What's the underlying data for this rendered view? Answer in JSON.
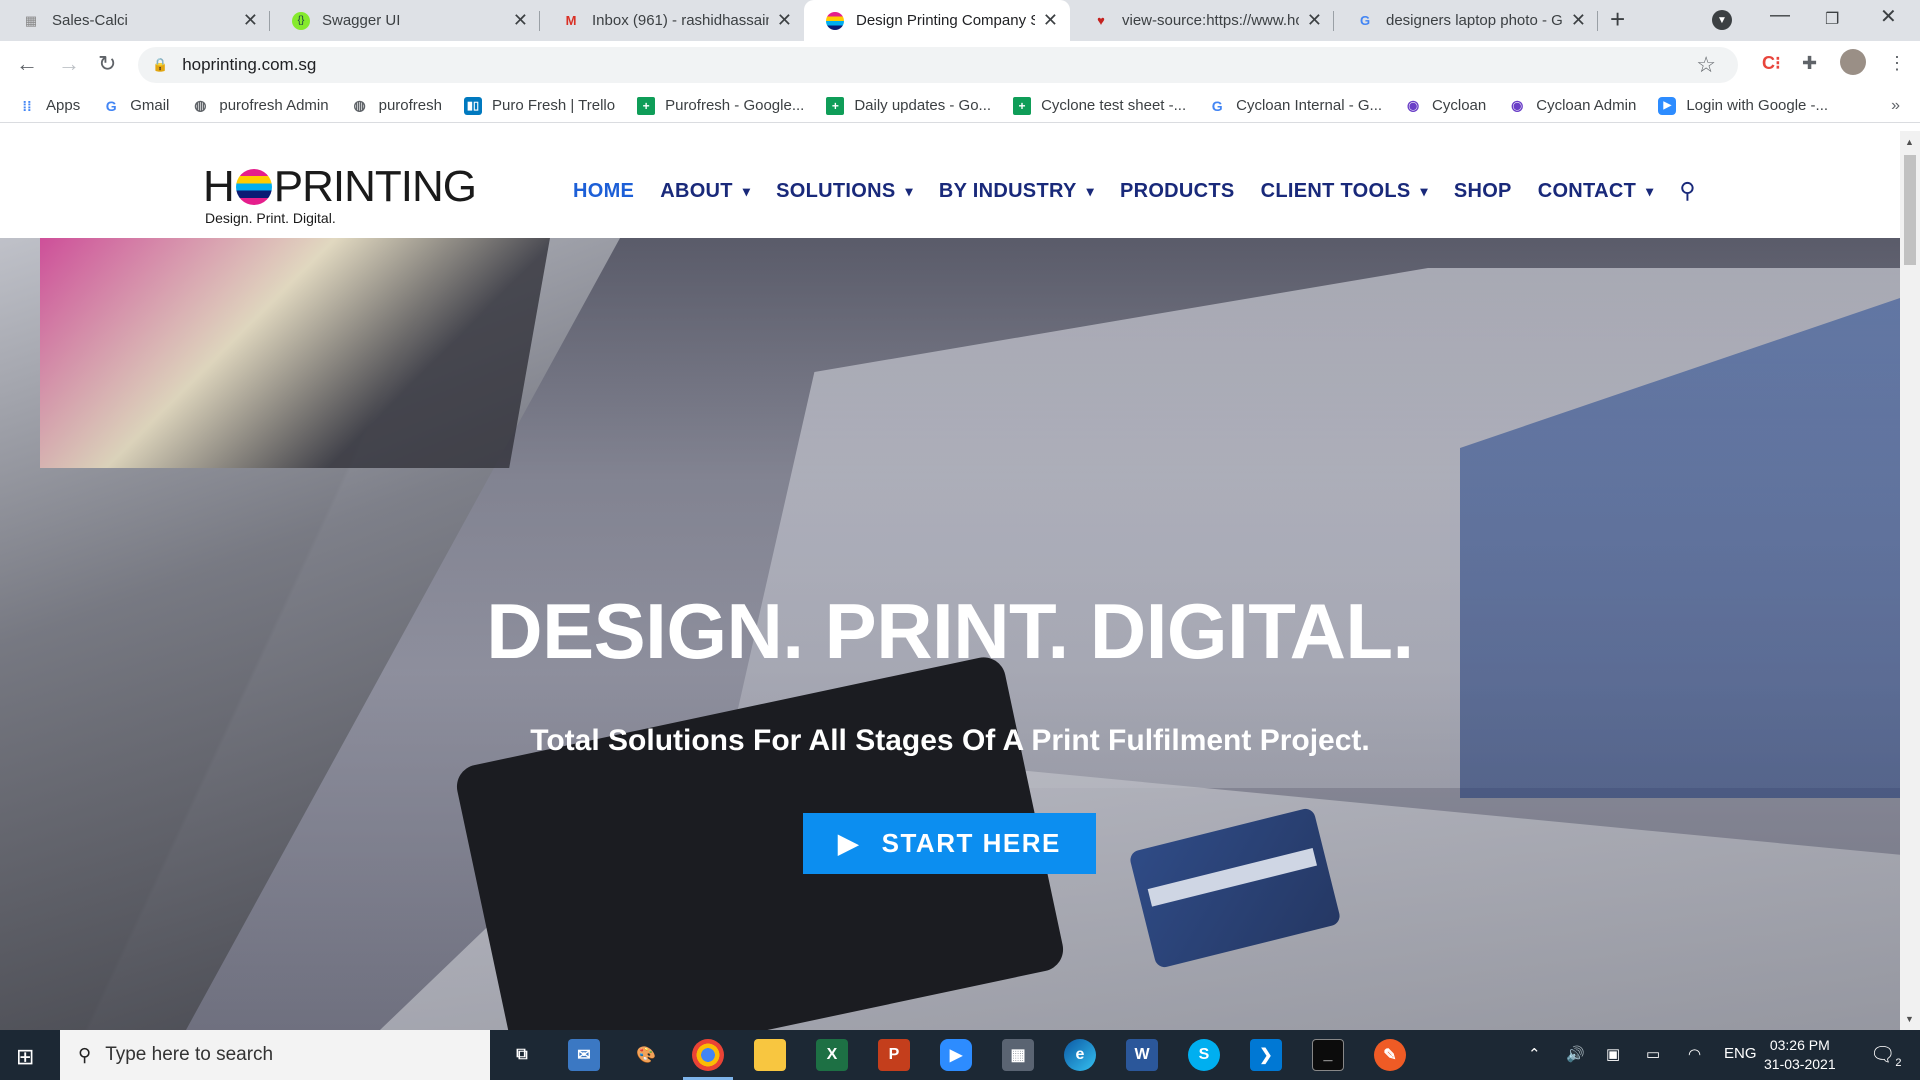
{
  "browser": {
    "tabs": [
      {
        "title": "Sales-Calci",
        "icon": "sales-icon",
        "active": false
      },
      {
        "title": "Swagger UI",
        "icon": "swagger-icon",
        "active": false
      },
      {
        "title": "Inbox (961) - rashidhassain",
        "icon": "gmail-icon",
        "active": false
      },
      {
        "title": "Design Printing Company S",
        "icon": "hoprinting-icon",
        "active": true
      },
      {
        "title": "view-source:https://www.ho",
        "icon": "view-source-icon",
        "active": false
      },
      {
        "title": "designers laptop photo - G",
        "icon": "google-icon",
        "active": false
      }
    ],
    "url": "hoprinting.com.sg",
    "bookmarks": [
      {
        "label": "Apps",
        "icon": "apps-grid-icon"
      },
      {
        "label": "Gmail",
        "icon": "google-icon"
      },
      {
        "label": "purofresh Admin",
        "icon": "globe-icon"
      },
      {
        "label": "purofresh",
        "icon": "globe-icon"
      },
      {
        "label": "Puro Fresh | Trello",
        "icon": "trello-icon"
      },
      {
        "label": "Purofresh - Google...",
        "icon": "sheets-icon"
      },
      {
        "label": "Daily updates - Go...",
        "icon": "sheets-icon"
      },
      {
        "label": "Cyclone test sheet -...",
        "icon": "sheets-icon"
      },
      {
        "label": "Cycloan Internal - G...",
        "icon": "google-icon"
      },
      {
        "label": "Cycloan",
        "icon": "cycloan-icon"
      },
      {
        "label": "Cycloan Admin",
        "icon": "cycloan-icon"
      },
      {
        "label": "Login with Google -...",
        "icon": "zoom-icon"
      }
    ],
    "bookmarks_more": "»"
  },
  "site": {
    "logo": {
      "text_left": "H",
      "text_right": "PRINTING",
      "tagline": "Design. Print. Digital."
    },
    "nav": [
      {
        "label": "HOME",
        "active": true,
        "has_dropdown": false
      },
      {
        "label": "ABOUT",
        "active": false,
        "has_dropdown": true
      },
      {
        "label": "SOLUTIONS",
        "active": false,
        "has_dropdown": true
      },
      {
        "label": "BY INDUSTRY",
        "active": false,
        "has_dropdown": true
      },
      {
        "label": "PRODUCTS",
        "active": false,
        "has_dropdown": false
      },
      {
        "label": "CLIENT TOOLS",
        "active": false,
        "has_dropdown": true
      },
      {
        "label": "SHOP",
        "active": false,
        "has_dropdown": false
      },
      {
        "label": "CONTACT",
        "active": false,
        "has_dropdown": true
      }
    ],
    "hero": {
      "title": "DESIGN. PRINT. DIGITAL.",
      "subtitle": "Total Solutions For All Stages Of A Print Fulfilment Project.",
      "cta": "START HERE"
    },
    "colors": {
      "nav": "#19297a",
      "nav_active": "#1d5fd7",
      "cta": "#0c8ef0"
    }
  },
  "taskbar": {
    "search_placeholder": "Type here to search",
    "apps": [
      "task-view-icon",
      "mail-icon",
      "paint-icon",
      "chrome-icon",
      "file-explorer-icon",
      "excel-icon",
      "powerpoint-icon",
      "zoom-icon",
      "calculator-icon",
      "edge-icon",
      "word-icon",
      "skype-icon",
      "vscode-icon",
      "terminal-icon",
      "postman-icon"
    ],
    "language": "ENG",
    "time": "03:26 PM",
    "date": "31-03-2021",
    "notifications": "2"
  }
}
